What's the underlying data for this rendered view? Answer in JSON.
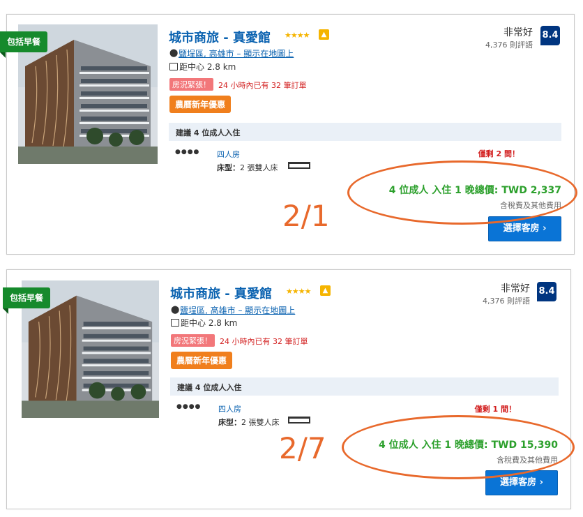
{
  "cards": [
    {
      "breakfast_tag": "包括早餐",
      "hotel_name": "城市商旅 - 真愛館",
      "stars": "★★★★",
      "thumb_icon": "thumbs-up-icon",
      "address": "鹽埕區, 高雄市 – 顯示在地圖上",
      "distance": "距中心 2.8 km",
      "urgency_badge": "房況緊張！",
      "booked_text": "24 小時內已有 32 筆訂單",
      "deal_badge": "農曆新年優惠",
      "review_word": "非常好",
      "review_count": "4,376 則評語",
      "score": "8.4",
      "recommend_text": "建議 4 位成人入住",
      "persons_icon": "●●●●",
      "room_type": "四人房",
      "bed_label": "床型：",
      "bed_value": "2 張雙人床",
      "rooms_left": "僅剩 2 間！",
      "price_text": "4 位成人 入住 1 晚總價: TWD 2,337",
      "tax_text": "含稅費及其他費用",
      "button_label": "選擇客房 ›",
      "annotation": "2/1"
    },
    {
      "breakfast_tag": "包括早餐",
      "hotel_name": "城市商旅 - 真愛館",
      "stars": "★★★★",
      "thumb_icon": "thumbs-up-icon",
      "address": "鹽埕區, 高雄市 – 顯示在地圖上",
      "distance": "距中心 2.8 km",
      "urgency_badge": "房況緊張！",
      "booked_text": "24 小時內已有 32 筆訂單",
      "deal_badge": "農曆新年優惠",
      "review_word": "非常好",
      "review_count": "4,376 則評語",
      "score": "8.4",
      "recommend_text": "建議 4 位成人入住",
      "persons_icon": "●●●●",
      "room_type": "四人房",
      "bed_label": "床型：",
      "bed_value": "2 張雙人床",
      "rooms_left": "僅剩 1 間！",
      "price_text": "4 位成人 入住 1 晚總價: TWD 15,390",
      "tax_text": "含稅費及其他費用",
      "button_label": "選擇客房 ›",
      "annotation": "2/7"
    }
  ],
  "colors": {
    "accent_blue": "#0a62b0",
    "score_bg": "#003580",
    "price_green": "#2ca02c",
    "annotation_orange": "#e8692c",
    "deal_orange": "#f07f1d",
    "breakfast_green": "#168a2c"
  }
}
